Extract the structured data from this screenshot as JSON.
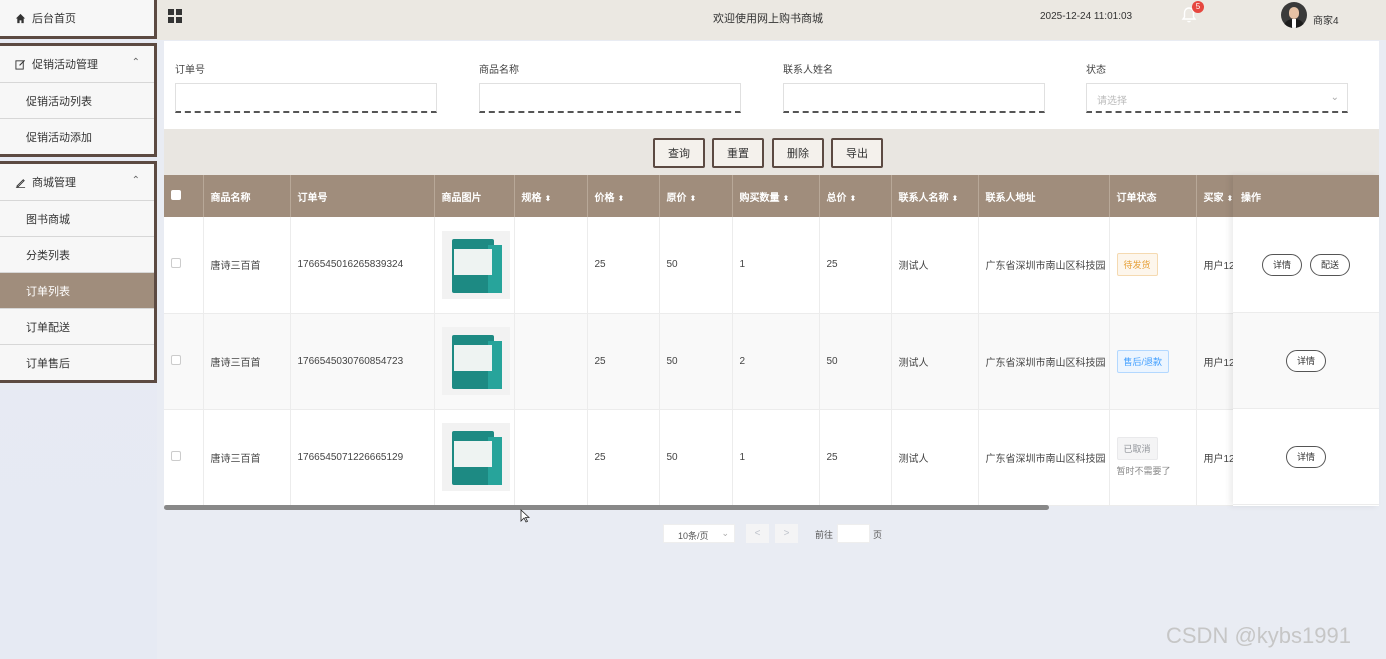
{
  "sidebar": {
    "home": "后台首页",
    "groups": [
      {
        "label": "促销活动管理",
        "items": [
          "促销活动列表",
          "促销活动添加"
        ]
      },
      {
        "label": "商城管理",
        "items": [
          "图书商城",
          "分类列表",
          "订单列表",
          "订单配送",
          "订单售后"
        ]
      }
    ],
    "active_item": "订单列表"
  },
  "topbar": {
    "welcome": "欢迎使用网上购书商城",
    "datetime": "2025-12-24 11:01:03",
    "notification_count": "5",
    "username": "商家4"
  },
  "search": {
    "order_no_label": "订单号",
    "goods_name_label": "商品名称",
    "contact_name_label": "联系人姓名",
    "status_label": "状态",
    "status_placeholder": "请选择"
  },
  "buttons": {
    "query": "查询",
    "reset": "重置",
    "delete": "删除",
    "export": "导出"
  },
  "table": {
    "columns": [
      "商品名称",
      "订单号",
      "商品图片",
      "规格",
      "价格",
      "原价",
      "购买数量",
      "总价",
      "联系人名称",
      "联系人地址",
      "订单状态",
      "买家",
      "操作"
    ],
    "rows": [
      {
        "goods": "唐诗三百首",
        "order_no": "1766545016265839324",
        "spec": "",
        "price": "25",
        "orig_price": "50",
        "qty": "1",
        "total": "25",
        "contact": "测试人",
        "address": "广东省深圳市南山区科技园",
        "status": "待发货",
        "status_note": "",
        "buyer": "用户12",
        "ops": [
          "详情",
          "配送"
        ]
      },
      {
        "goods": "唐诗三百首",
        "order_no": "1766545030760854723",
        "spec": "",
        "price": "25",
        "orig_price": "50",
        "qty": "2",
        "total": "50",
        "contact": "测试人",
        "address": "广东省深圳市南山区科技园",
        "status": "售后/退款",
        "status_note": "",
        "buyer": "用户12",
        "ops": [
          "详情"
        ]
      },
      {
        "goods": "唐诗三百首",
        "order_no": "1766545071226665129",
        "spec": "",
        "price": "25",
        "orig_price": "50",
        "qty": "1",
        "total": "25",
        "contact": "测试人",
        "address": "广东省深圳市南山区科技园",
        "status": "已取消",
        "status_note": "暂时不需要了",
        "buyer": "用户12",
        "ops": [
          "详情"
        ]
      }
    ]
  },
  "pagination": {
    "page_size": "10条/页",
    "prev": "<",
    "next": ">",
    "goto_prefix": "前往",
    "goto_suffix": "页"
  },
  "watermark": "CSDN @kybs1991",
  "colors": {
    "accent": "#a08d7c",
    "border_dark": "#5c4a42"
  }
}
